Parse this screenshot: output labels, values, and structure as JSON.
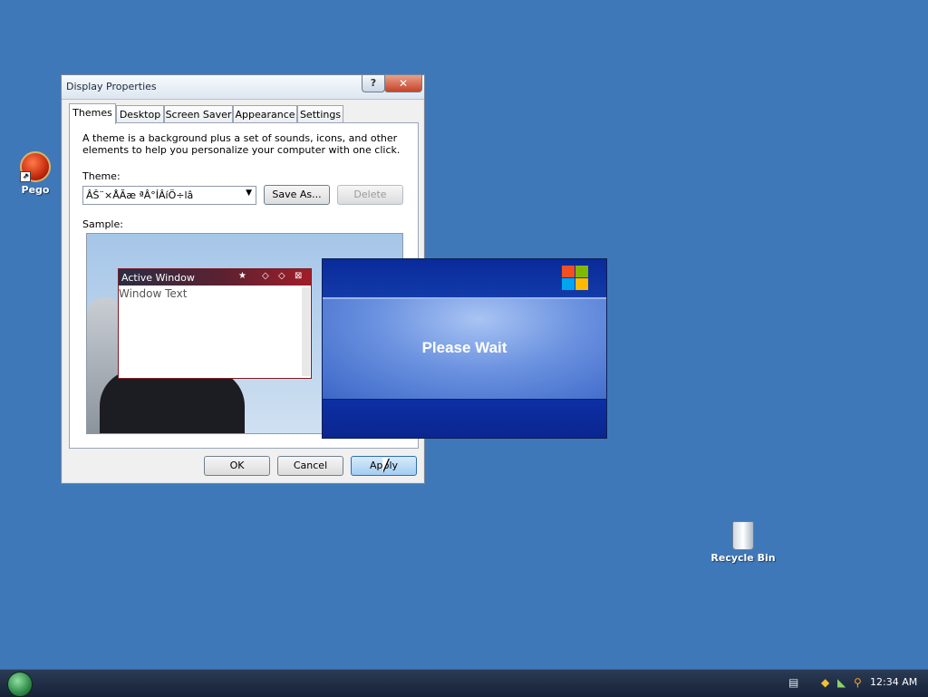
{
  "desktop": {
    "icons": [
      {
        "label": "Pego"
      },
      {
        "label": "Recycle Bin"
      }
    ]
  },
  "window": {
    "title": "Display Properties",
    "help_label": "?",
    "close_label": "✕",
    "tabs": [
      {
        "label": "Themes"
      },
      {
        "label": "Desktop"
      },
      {
        "label": "Screen Saver"
      },
      {
        "label": "Appearance"
      },
      {
        "label": "Settings"
      }
    ],
    "description": "A theme is a background plus a set of sounds, icons, and other elements to help you personalize your computer with one click.",
    "theme_label": "Theme:",
    "theme_value": "ÂŠ¨×ÅÃæ ªÂ°ÍÂíÖ÷lâ",
    "save_as_label": "Save As...",
    "delete_label": "Delete",
    "sample_label": "Sample:",
    "sample": {
      "active_window_title": "Active Window",
      "window_text": "Window Text"
    },
    "ok_label": "OK",
    "cancel_label": "Cancel",
    "apply_label": "Apply"
  },
  "splash": {
    "text": "Please Wait"
  },
  "taskbar": {
    "clock": "12:34 AM"
  }
}
